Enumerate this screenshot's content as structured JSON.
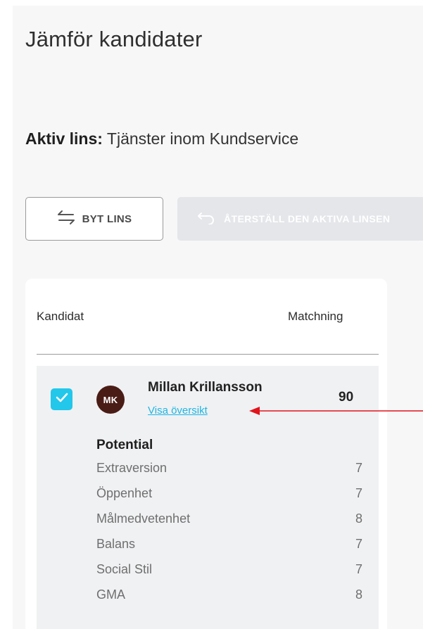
{
  "page": {
    "title": "Jämför kandidater"
  },
  "lens": {
    "label": "Aktiv lins:",
    "value": "Tjänster inom Kundservice"
  },
  "toolbar": {
    "switch_lens_label": "BYT LINS",
    "reset_lens_label": "ÅTERSTÄLL DEN AKTIVA LINSEN"
  },
  "table": {
    "col_candidate": "Kandidat",
    "col_match": "Matchning"
  },
  "candidate": {
    "initials": "MK",
    "name": "Millan Krillansson",
    "overview_link": "Visa översikt",
    "score": "90",
    "selected": true,
    "traits_heading": "Potential",
    "traits": [
      {
        "name": "Extraversion",
        "value": "7"
      },
      {
        "name": "Öppenhet",
        "value": "7"
      },
      {
        "name": "Målmedvetenhet",
        "value": "8"
      },
      {
        "name": "Balans",
        "value": "7"
      },
      {
        "name": "Social Stil",
        "value": "7"
      },
      {
        "name": "GMA",
        "value": "8"
      }
    ]
  },
  "colors": {
    "accent": "#22c7ea",
    "link": "#1fb6e3",
    "avatar_bg": "#4a1c16",
    "annotation_arrow": "#e0141b"
  },
  "icons": {
    "switch": "swap-arrows-icon",
    "reset": "undo-arrow-icon",
    "checkbox": "checkmark-icon"
  }
}
